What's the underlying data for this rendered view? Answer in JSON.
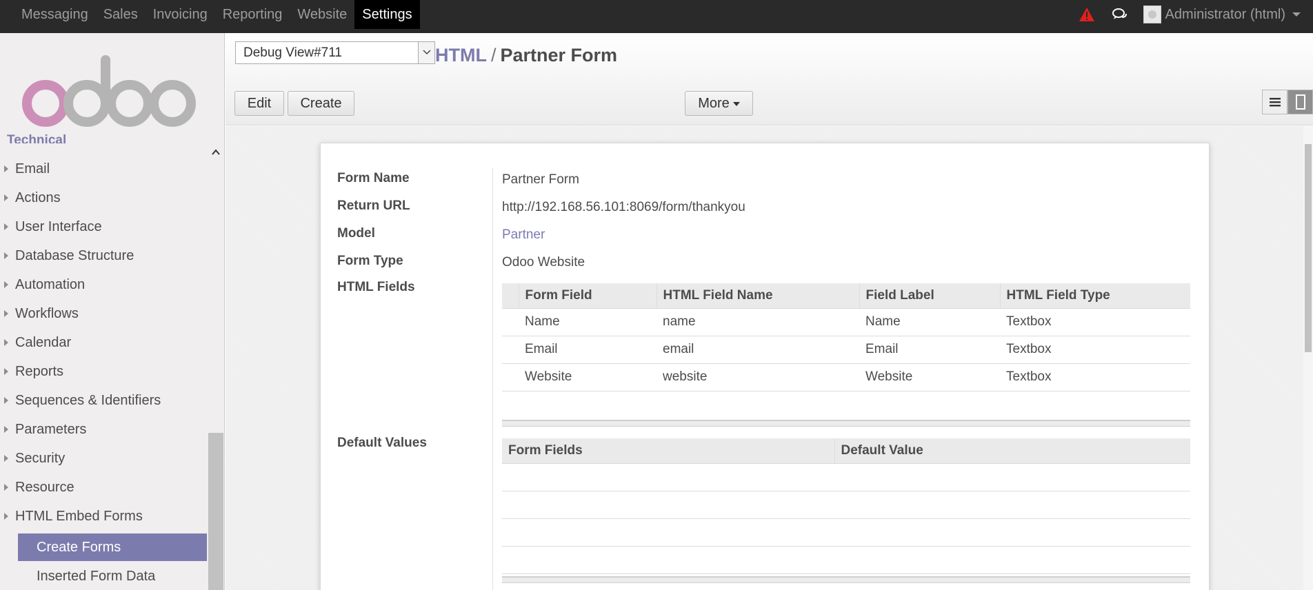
{
  "topbar": {
    "menu": [
      "Messaging",
      "Sales",
      "Invoicing",
      "Reporting",
      "Website",
      "Settings"
    ],
    "active_menu": "Settings",
    "user": "Administrator (html)"
  },
  "sidebar": {
    "heading": "Technical",
    "items": [
      "Email",
      "Actions",
      "User Interface",
      "Database Structure",
      "Automation",
      "Workflows",
      "Calendar",
      "Reports",
      "Sequences & Identifiers",
      "Parameters",
      "Security",
      "Resource",
      "HTML Embed Forms"
    ],
    "subitems": [
      "Create Forms",
      "Inserted Form Data"
    ],
    "active_subitem": "Create Forms"
  },
  "control_panel": {
    "debug_select": "Debug View#711",
    "breadcrumb_parent": "HTML",
    "breadcrumb_sep": "/",
    "breadcrumb_current": "Partner Form",
    "edit_label": "Edit",
    "create_label": "Create",
    "more_label": "More"
  },
  "form": {
    "labels": {
      "form_name": "Form Name",
      "return_url": "Return URL",
      "model": "Model",
      "form_type": "Form Type",
      "html_fields": "HTML Fields",
      "default_values": "Default Values"
    },
    "values": {
      "form_name": "Partner Form",
      "return_url": "http://192.168.56.101:8069/form/thankyou",
      "model": "Partner",
      "form_type": "Odoo Website"
    },
    "html_fields_table": {
      "headers": [
        "Form Field",
        "HTML Field Name",
        "Field Label",
        "HTML Field Type"
      ],
      "rows": [
        [
          "Name",
          "name",
          "Name",
          "Textbox"
        ],
        [
          "Email",
          "email",
          "Email",
          "Textbox"
        ],
        [
          "Website",
          "website",
          "Website",
          "Textbox"
        ]
      ]
    },
    "default_values_table": {
      "headers": [
        "Form Fields",
        "Default Value"
      ]
    }
  },
  "colors": {
    "topbar_bg": "#2a2a2a",
    "accent": "#7c7bad",
    "alert": "#e0201c"
  }
}
